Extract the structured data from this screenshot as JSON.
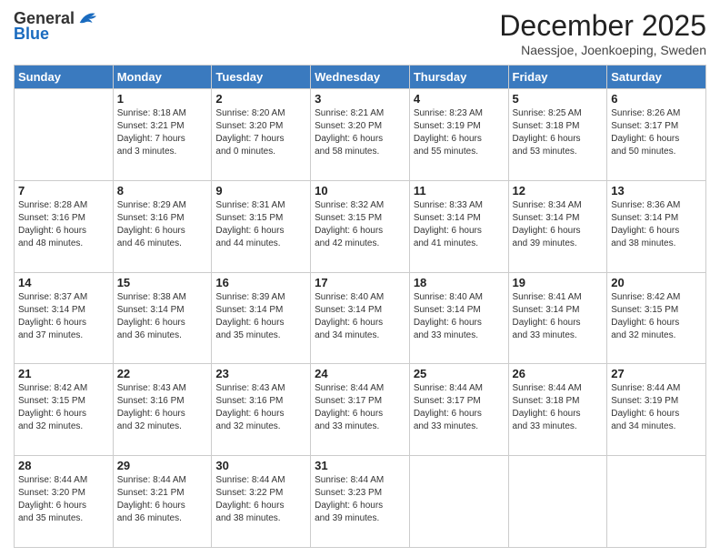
{
  "logo": {
    "general": "General",
    "blue": "Blue"
  },
  "title": "December 2025",
  "subtitle": "Naessjoe, Joenkoeping, Sweden",
  "header_days": [
    "Sunday",
    "Monday",
    "Tuesday",
    "Wednesday",
    "Thursday",
    "Friday",
    "Saturday"
  ],
  "weeks": [
    [
      {
        "day": "",
        "info": ""
      },
      {
        "day": "1",
        "info": "Sunrise: 8:18 AM\nSunset: 3:21 PM\nDaylight: 7 hours\nand 3 minutes."
      },
      {
        "day": "2",
        "info": "Sunrise: 8:20 AM\nSunset: 3:20 PM\nDaylight: 7 hours\nand 0 minutes."
      },
      {
        "day": "3",
        "info": "Sunrise: 8:21 AM\nSunset: 3:20 PM\nDaylight: 6 hours\nand 58 minutes."
      },
      {
        "day": "4",
        "info": "Sunrise: 8:23 AM\nSunset: 3:19 PM\nDaylight: 6 hours\nand 55 minutes."
      },
      {
        "day": "5",
        "info": "Sunrise: 8:25 AM\nSunset: 3:18 PM\nDaylight: 6 hours\nand 53 minutes."
      },
      {
        "day": "6",
        "info": "Sunrise: 8:26 AM\nSunset: 3:17 PM\nDaylight: 6 hours\nand 50 minutes."
      }
    ],
    [
      {
        "day": "7",
        "info": "Sunrise: 8:28 AM\nSunset: 3:16 PM\nDaylight: 6 hours\nand 48 minutes."
      },
      {
        "day": "8",
        "info": "Sunrise: 8:29 AM\nSunset: 3:16 PM\nDaylight: 6 hours\nand 46 minutes."
      },
      {
        "day": "9",
        "info": "Sunrise: 8:31 AM\nSunset: 3:15 PM\nDaylight: 6 hours\nand 44 minutes."
      },
      {
        "day": "10",
        "info": "Sunrise: 8:32 AM\nSunset: 3:15 PM\nDaylight: 6 hours\nand 42 minutes."
      },
      {
        "day": "11",
        "info": "Sunrise: 8:33 AM\nSunset: 3:14 PM\nDaylight: 6 hours\nand 41 minutes."
      },
      {
        "day": "12",
        "info": "Sunrise: 8:34 AM\nSunset: 3:14 PM\nDaylight: 6 hours\nand 39 minutes."
      },
      {
        "day": "13",
        "info": "Sunrise: 8:36 AM\nSunset: 3:14 PM\nDaylight: 6 hours\nand 38 minutes."
      }
    ],
    [
      {
        "day": "14",
        "info": "Sunrise: 8:37 AM\nSunset: 3:14 PM\nDaylight: 6 hours\nand 37 minutes."
      },
      {
        "day": "15",
        "info": "Sunrise: 8:38 AM\nSunset: 3:14 PM\nDaylight: 6 hours\nand 36 minutes."
      },
      {
        "day": "16",
        "info": "Sunrise: 8:39 AM\nSunset: 3:14 PM\nDaylight: 6 hours\nand 35 minutes."
      },
      {
        "day": "17",
        "info": "Sunrise: 8:40 AM\nSunset: 3:14 PM\nDaylight: 6 hours\nand 34 minutes."
      },
      {
        "day": "18",
        "info": "Sunrise: 8:40 AM\nSunset: 3:14 PM\nDaylight: 6 hours\nand 33 minutes."
      },
      {
        "day": "19",
        "info": "Sunrise: 8:41 AM\nSunset: 3:14 PM\nDaylight: 6 hours\nand 33 minutes."
      },
      {
        "day": "20",
        "info": "Sunrise: 8:42 AM\nSunset: 3:15 PM\nDaylight: 6 hours\nand 32 minutes."
      }
    ],
    [
      {
        "day": "21",
        "info": "Sunrise: 8:42 AM\nSunset: 3:15 PM\nDaylight: 6 hours\nand 32 minutes."
      },
      {
        "day": "22",
        "info": "Sunrise: 8:43 AM\nSunset: 3:16 PM\nDaylight: 6 hours\nand 32 minutes."
      },
      {
        "day": "23",
        "info": "Sunrise: 8:43 AM\nSunset: 3:16 PM\nDaylight: 6 hours\nand 32 minutes."
      },
      {
        "day": "24",
        "info": "Sunrise: 8:44 AM\nSunset: 3:17 PM\nDaylight: 6 hours\nand 33 minutes."
      },
      {
        "day": "25",
        "info": "Sunrise: 8:44 AM\nSunset: 3:17 PM\nDaylight: 6 hours\nand 33 minutes."
      },
      {
        "day": "26",
        "info": "Sunrise: 8:44 AM\nSunset: 3:18 PM\nDaylight: 6 hours\nand 33 minutes."
      },
      {
        "day": "27",
        "info": "Sunrise: 8:44 AM\nSunset: 3:19 PM\nDaylight: 6 hours\nand 34 minutes."
      }
    ],
    [
      {
        "day": "28",
        "info": "Sunrise: 8:44 AM\nSunset: 3:20 PM\nDaylight: 6 hours\nand 35 minutes."
      },
      {
        "day": "29",
        "info": "Sunrise: 8:44 AM\nSunset: 3:21 PM\nDaylight: 6 hours\nand 36 minutes."
      },
      {
        "day": "30",
        "info": "Sunrise: 8:44 AM\nSunset: 3:22 PM\nDaylight: 6 hours\nand 38 minutes."
      },
      {
        "day": "31",
        "info": "Sunrise: 8:44 AM\nSunset: 3:23 PM\nDaylight: 6 hours\nand 39 minutes."
      },
      {
        "day": "",
        "info": ""
      },
      {
        "day": "",
        "info": ""
      },
      {
        "day": "",
        "info": ""
      }
    ]
  ]
}
